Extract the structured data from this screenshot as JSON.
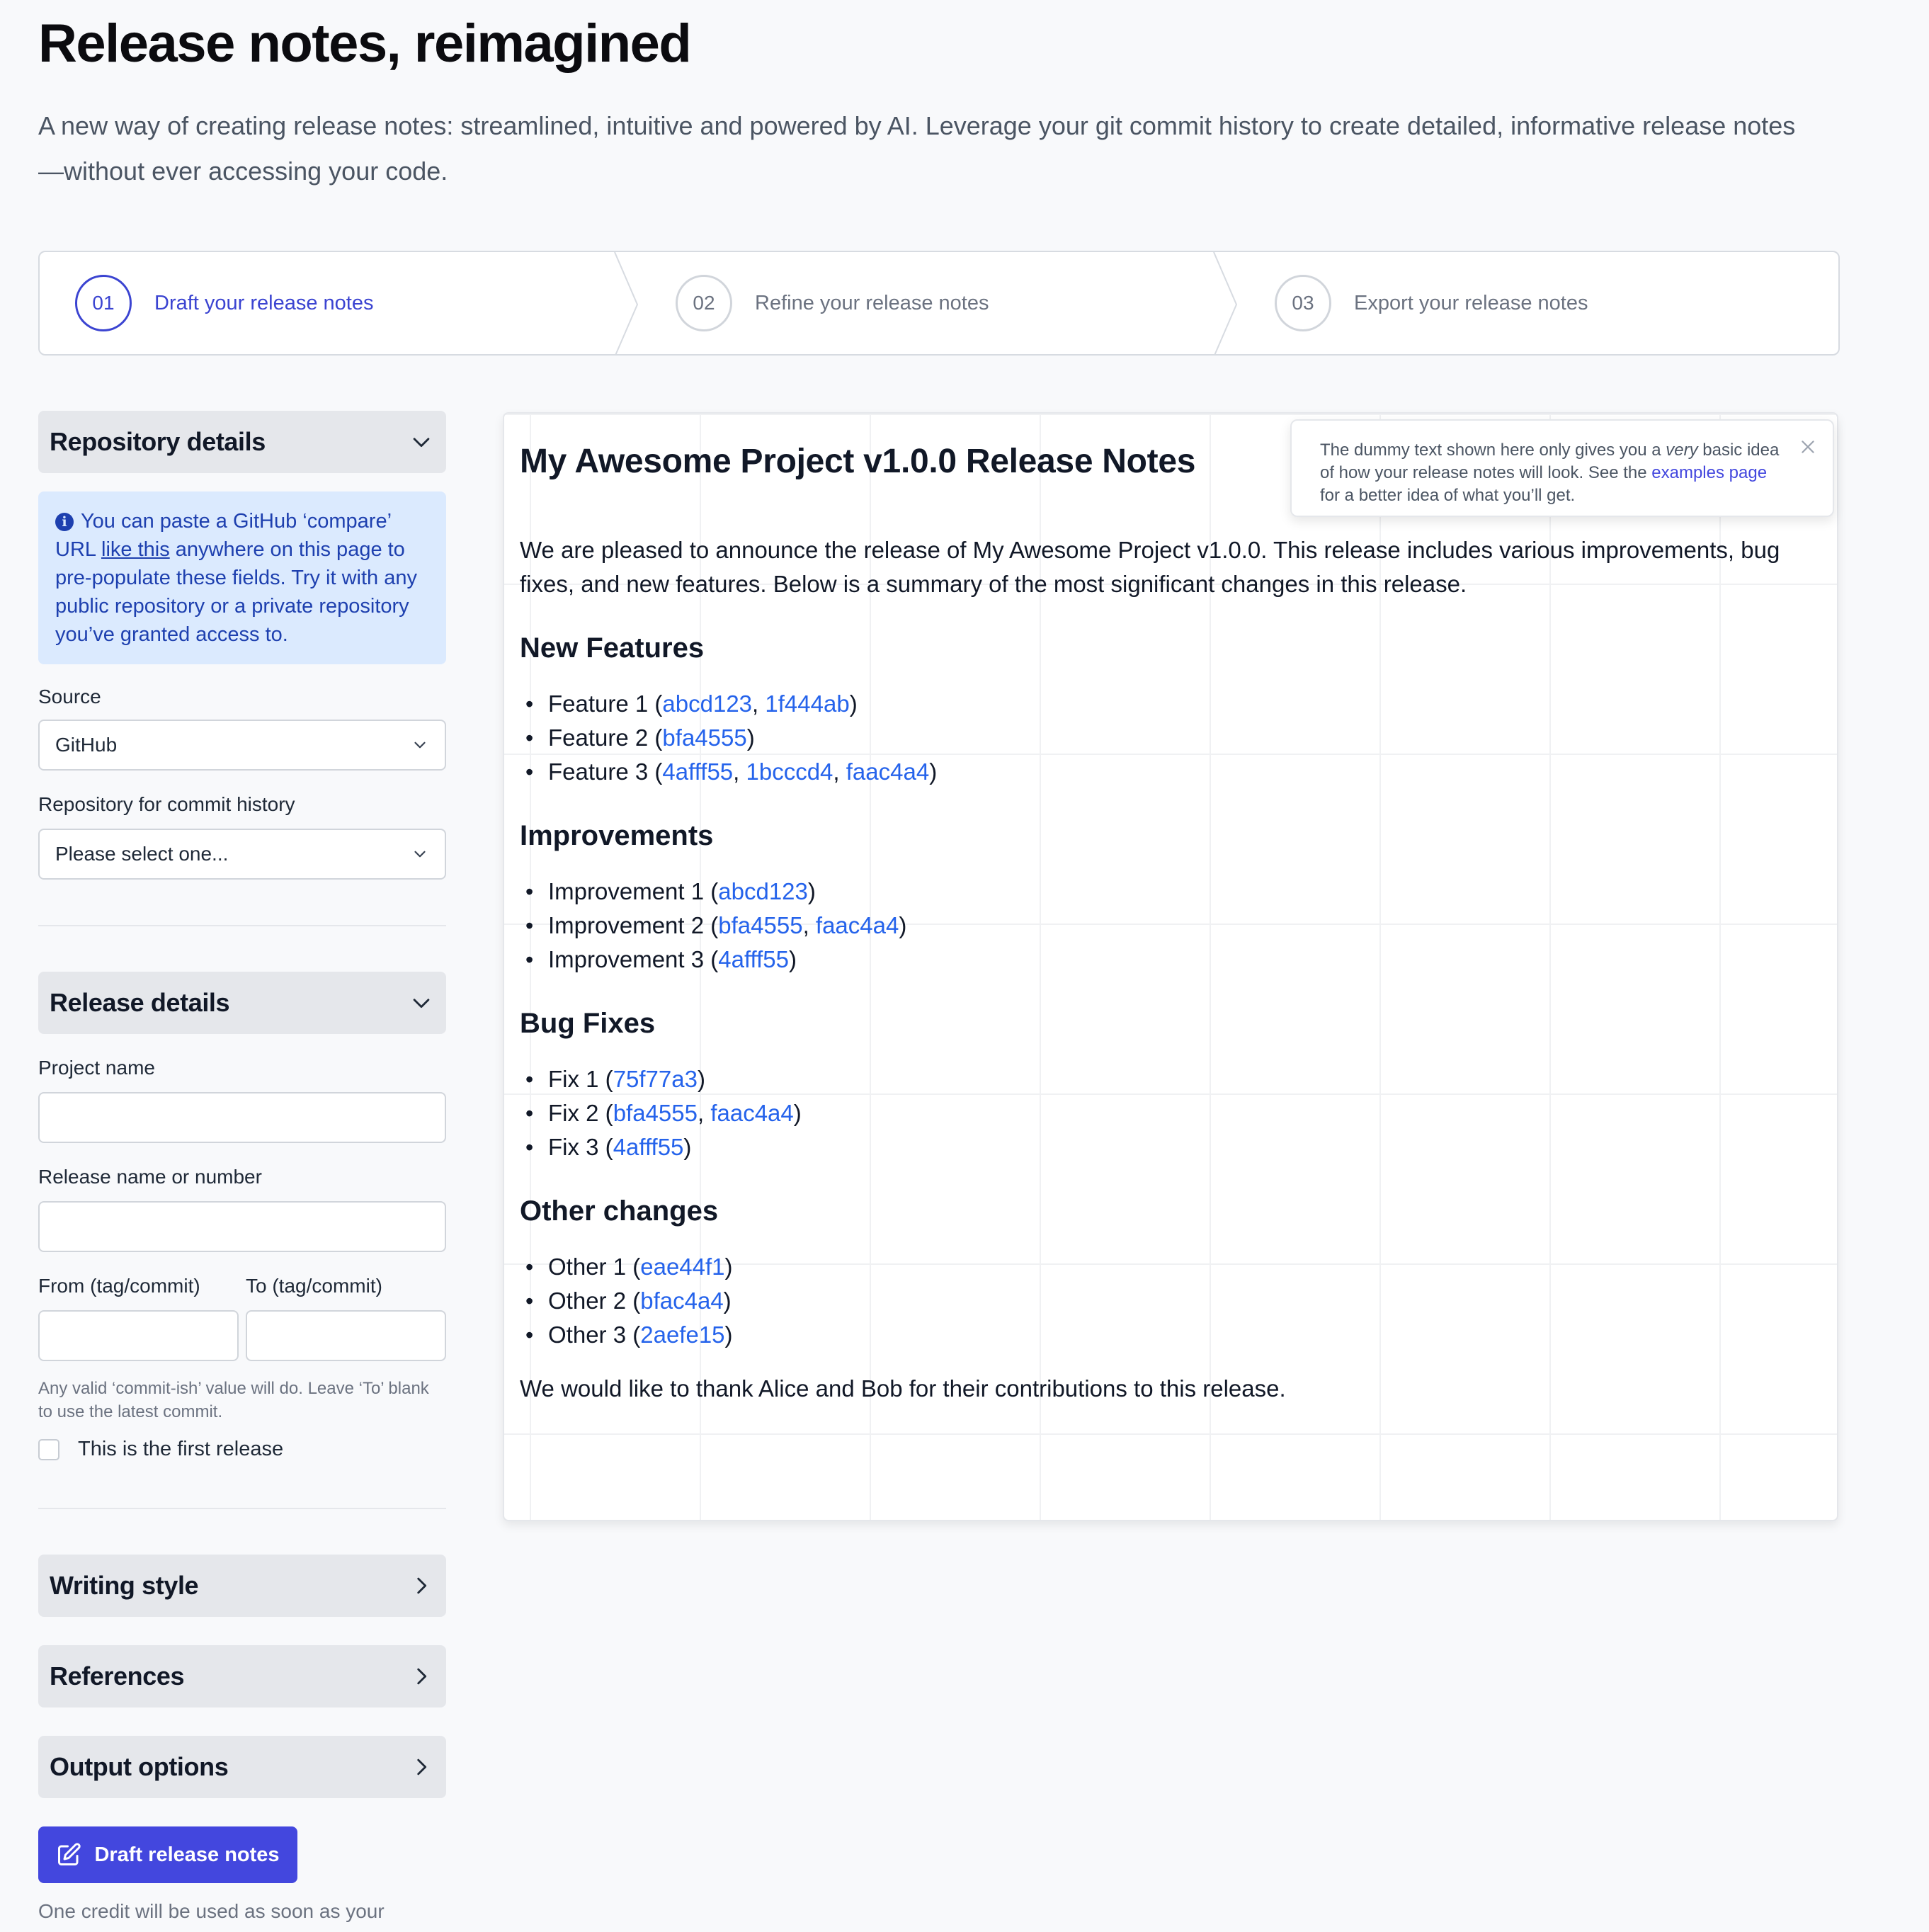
{
  "hero": {
    "title": "Release notes, reimagined",
    "subtitle": "A new way of creating release notes: streamlined, intuitive and powered by AI. Leverage your git commit history to create detailed, informative release notes—without ever accessing your code."
  },
  "steps": [
    {
      "num": "01",
      "label": "Draft your release notes"
    },
    {
      "num": "02",
      "label": "Refine your release notes"
    },
    {
      "num": "03",
      "label": "Export your release notes"
    }
  ],
  "sidebar": {
    "repository": {
      "title": "Repository details",
      "info_pre": "You can paste a GitHub ‘compare’ URL ",
      "info_link": "like this",
      "info_post": " anywhere on this page to pre-populate these fields. Try it with any public repository or a private repository you’ve granted access to.",
      "source_label": "Source",
      "source_value": "GitHub",
      "repo_label": "Repository for commit history",
      "repo_value": "Please select one..."
    },
    "release": {
      "title": "Release details",
      "project_label": "Project name",
      "release_label": "Release name or number",
      "from_label": "From (tag/commit)",
      "to_label": "To (tag/commit)",
      "hint": "Any valid ‘commit-ish’ value will do. Leave ‘To’ blank to use the latest commit.",
      "first_release_label": "This is the first release"
    },
    "writing_style": "Writing style",
    "references": "References",
    "output_options": "Output options",
    "draft_button": "Draft release notes",
    "credit_note": "One credit will be used as soon as your"
  },
  "tooltip": {
    "pre": "The dummy text shown here only gives you a ",
    "emph": "very",
    "mid": " basic idea of how your release notes will look. See the ",
    "link": "examples page",
    "post": " for a better idea of what you’ll get."
  },
  "preview": {
    "title": "My Awesome Project v1.0.0 Release Notes",
    "intro": "We are pleased to announce the release of My Awesome Project v1.0.0. This release includes various improvements, bug fixes, and new features. Below is a summary of the most significant changes in this release.",
    "sections": [
      {
        "heading": "New Features",
        "items": [
          {
            "text": "Feature 1",
            "commits": [
              "abcd123",
              "1f444ab"
            ]
          },
          {
            "text": "Feature 2",
            "commits": [
              "bfa4555"
            ]
          },
          {
            "text": "Feature 3",
            "commits": [
              "4afff55",
              "1bcccd4",
              "faac4a4"
            ]
          }
        ]
      },
      {
        "heading": "Improvements",
        "items": [
          {
            "text": "Improvement 1",
            "commits": [
              "abcd123"
            ]
          },
          {
            "text": "Improvement 2",
            "commits": [
              "bfa4555",
              "faac4a4"
            ]
          },
          {
            "text": "Improvement 3",
            "commits": [
              "4afff55"
            ]
          }
        ]
      },
      {
        "heading": "Bug Fixes",
        "items": [
          {
            "text": "Fix 1",
            "commits": [
              "75f77a3"
            ]
          },
          {
            "text": "Fix 2",
            "commits": [
              "bfa4555",
              "faac4a4"
            ]
          },
          {
            "text": "Fix 3",
            "commits": [
              "4afff55"
            ]
          }
        ]
      },
      {
        "heading": "Other changes",
        "items": [
          {
            "text": "Other 1",
            "commits": [
              "eae44f1"
            ]
          },
          {
            "text": "Other 2",
            "commits": [
              "bfac4a4"
            ]
          },
          {
            "text": "Other 3",
            "commits": [
              "2aefe15"
            ]
          }
        ]
      }
    ],
    "thanks": "We would like to thank Alice and Bob for their contributions to this release."
  },
  "colors": {
    "accent": "#4347de",
    "link": "#2563eb",
    "info_bg": "#dbeafe",
    "info_text": "#1e40af"
  }
}
